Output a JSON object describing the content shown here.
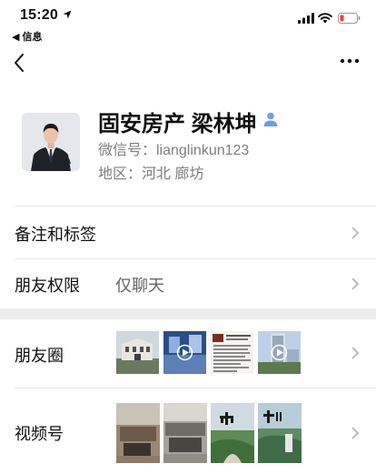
{
  "status_bar": {
    "time": "15:20",
    "back_app": "◀ 信息"
  },
  "profile": {
    "name": "固安房产 梁林坤",
    "wechat_id": "微信号：lianglinkun123",
    "region": "地区：河北 廊坊"
  },
  "rows": {
    "remarks_tags": {
      "label": "备注和标签"
    },
    "friend_permissions": {
      "label": "朋友权限",
      "value": "仅聊天"
    },
    "moments": {
      "label": "朋友圈"
    },
    "channels": {
      "label": "视频号"
    }
  },
  "colors": {
    "accent_blue": "#6f9fd8",
    "divider": "#e6e6e6",
    "section_gap": "#ededed",
    "battery_low": "#ff3b30"
  },
  "icons": [
    "location-arrow-icon",
    "signal-icon",
    "wifi-icon",
    "battery-icon",
    "back-chevron-icon",
    "more-icon",
    "person-icon",
    "chevron-right-icon",
    "play-icon"
  ]
}
